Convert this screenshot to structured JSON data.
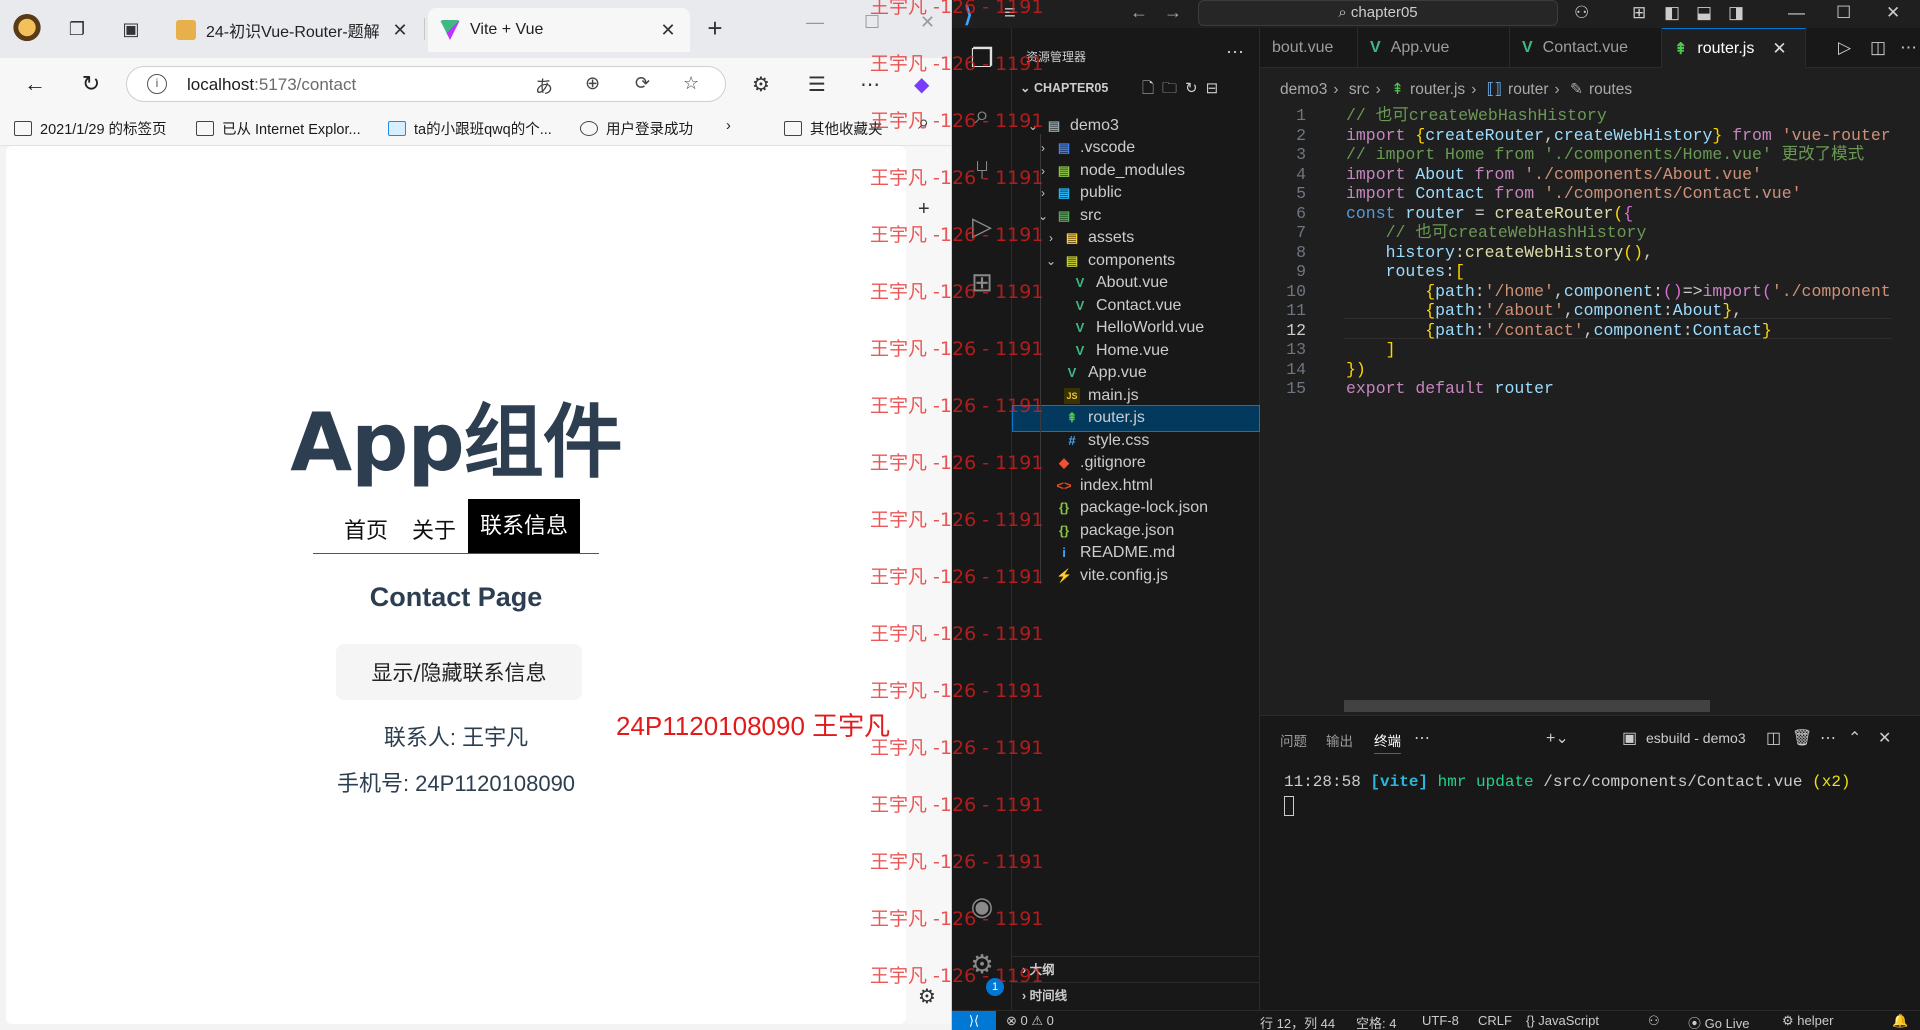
{
  "browser": {
    "tabs": [
      {
        "title": "24-初识Vue-Router-题解",
        "active": false
      },
      {
        "title": "Vite + Vue",
        "active": true
      }
    ],
    "url_host": "localhost",
    "url_path": ":5173/contact",
    "bookmarks": [
      "2021/1/29 的标签页",
      "已从 Internet Explor...",
      "ta的小跟班qwq的个...",
      "用户登录成功",
      "其他收藏夹"
    ]
  },
  "page": {
    "app_title": "App组件",
    "routes": [
      {
        "label": "首页",
        "active": false
      },
      {
        "label": "关于",
        "active": false
      },
      {
        "label": "联系信息",
        "active": true
      }
    ],
    "contact_title": "Contact Page",
    "toggle_button": "显示/隐藏联系信息",
    "contact_person": "联系人: 王宇凡",
    "phone": "手机号: 24P1120108090",
    "red_note": "24P1120108090 王宇凡"
  },
  "watermark": "王宇凡 -126 - 1191",
  "vscode": {
    "search": "chapter05",
    "explorer_header": "资源管理器",
    "project": "CHAPTER05",
    "tree": [
      {
        "name": "demo3",
        "kind": "folder-open",
        "level": 1
      },
      {
        "name": ".vscode",
        "kind": "folder",
        "level": 2
      },
      {
        "name": "node_modules",
        "kind": "folder",
        "level": 2
      },
      {
        "name": "public",
        "kind": "folder",
        "level": 2
      },
      {
        "name": "src",
        "kind": "folder-open",
        "level": 2
      },
      {
        "name": "assets",
        "kind": "folder",
        "level": 3
      },
      {
        "name": "components",
        "kind": "folder-open",
        "level": 3
      },
      {
        "name": "About.vue",
        "kind": "vue",
        "level": 4
      },
      {
        "name": "Contact.vue",
        "kind": "vue",
        "level": 4
      },
      {
        "name": "HelloWorld.vue",
        "kind": "vue",
        "level": 4
      },
      {
        "name": "Home.vue",
        "kind": "vue",
        "level": 4
      },
      {
        "name": "App.vue",
        "kind": "vue",
        "level": 3
      },
      {
        "name": "main.js",
        "kind": "js",
        "level": 3
      },
      {
        "name": "router.js",
        "kind": "router",
        "level": 3,
        "selected": true
      },
      {
        "name": "style.css",
        "kind": "css",
        "level": 3
      },
      {
        "name": ".gitignore",
        "kind": "git",
        "level": 2
      },
      {
        "name": "index.html",
        "kind": "html",
        "level": 2
      },
      {
        "name": "package-lock.json",
        "kind": "json",
        "level": 2
      },
      {
        "name": "package.json",
        "kind": "json",
        "level": 2
      },
      {
        "name": "README.md",
        "kind": "info",
        "level": 2
      },
      {
        "name": "vite.config.js",
        "kind": "vite",
        "level": 2
      }
    ],
    "sections": [
      "大纲",
      "时间线"
    ],
    "editor_tabs": [
      "bout.vue",
      "App.vue",
      "Contact.vue",
      "router.js"
    ],
    "breadcrumb": [
      "demo3",
      "src",
      "router.js",
      "router",
      "routes"
    ],
    "code": [
      "// 也可createWebHashHistory",
      "import {createRouter,createWebHistory} from 'vue-router'",
      "// import Home from './components/Home.vue' 更改了模式",
      "import About from './components/About.vue'",
      "import Contact from './components/Contact.vue'",
      "const router = createRouter({",
      "    // 也可createWebHashHistory",
      "    history:createWebHistory(),",
      "    routes:[",
      "        {path:'/home',component:()=>import('./components/Home.vue')},",
      "        {path:'/about',component:About},",
      "        {path:'/contact',component:Contact}",
      "    ]",
      "})",
      "export default router"
    ],
    "current_line": 12,
    "panel_tabs": [
      "问题",
      "输出",
      "终端"
    ],
    "terminal_name": "esbuild - demo3",
    "terminal_output": {
      "time": "11:28:58",
      "tag": "[vite]",
      "msg": "hmr update",
      "path": "/src/components/Contact.vue",
      "count": "(x2)"
    },
    "status": {
      "errors": "0",
      "warnings": "0",
      "position": "行 12，列 44",
      "spaces": "空格: 4",
      "encoding": "UTF-8",
      "eol": "CRLF",
      "language": "JavaScript",
      "golive": "Go Live",
      "helper": "helper"
    },
    "settings_badge": "1"
  }
}
